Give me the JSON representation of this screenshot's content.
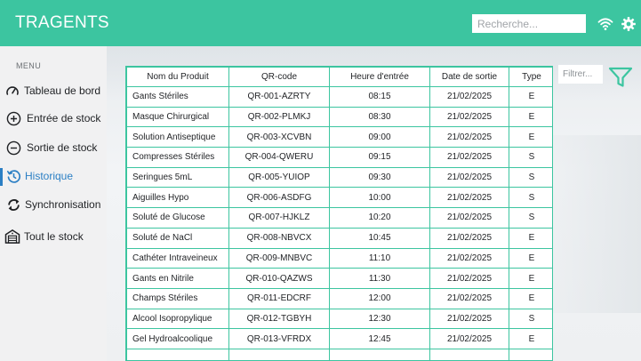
{
  "header": {
    "title": "TRAGENTS",
    "search_placeholder": "Recherche...",
    "icons": [
      "wifi-icon",
      "gear-icon"
    ]
  },
  "sidebar": {
    "menu_label": "MENU",
    "items": [
      {
        "label": "Tableau de bord",
        "icon": "gauge-icon",
        "active": false
      },
      {
        "label": "Entrée de stock",
        "icon": "plus-circle-icon",
        "active": false
      },
      {
        "label": "Sortie de stock",
        "icon": "minus-circle-icon",
        "active": false
      },
      {
        "label": "Historique",
        "icon": "history-icon",
        "active": true
      },
      {
        "label": "Synchronisation",
        "icon": "sync-icon",
        "active": false
      },
      {
        "label": "Tout le stock",
        "icon": "warehouse-icon",
        "active": false
      }
    ]
  },
  "filter": {
    "placeholder": "Filtrer..."
  },
  "table": {
    "headers": [
      "Nom du Produit",
      "QR-code",
      "Heure d'entrée",
      "Date de sortie",
      "Type"
    ],
    "rows": [
      [
        "Gants Stériles",
        "QR-001-AZRTY",
        "08:15",
        "21/02/2025",
        "E"
      ],
      [
        "Masque Chirurgical",
        "QR-002-PLMKJ",
        "08:30",
        "21/02/2025",
        "E"
      ],
      [
        "Solution Antiseptique",
        "QR-003-XCVBN",
        "09:00",
        "21/02/2025",
        "E"
      ],
      [
        "Compresses Stériles",
        "QR-004-QWERU",
        "09:15",
        "21/02/2025",
        "S"
      ],
      [
        "Seringues 5mL",
        "QR-005-YUIOP",
        "09:30",
        "21/02/2025",
        "S"
      ],
      [
        "Aiguilles Hypo",
        "QR-006-ASDFG",
        "10:00",
        "21/02/2025",
        "S"
      ],
      [
        "Soluté de Glucose",
        "QR-007-HJKLZ",
        "10:20",
        "21/02/2025",
        "S"
      ],
      [
        "Soluté de NaCl",
        "QR-008-NBVCX",
        "10:45",
        "21/02/2025",
        "E"
      ],
      [
        "Cathéter Intraveineux",
        "QR-009-MNBVC",
        "11:10",
        "21/02/2025",
        "E"
      ],
      [
        "Gants en Nitrile",
        "QR-010-QAZWS",
        "11:30",
        "21/02/2025",
        "E"
      ],
      [
        "Champs Stériles",
        "QR-011-EDCRF",
        "12:00",
        "21/02/2025",
        "E"
      ],
      [
        "Alcool Isopropylique",
        "QR-012-TGBYH",
        "12:30",
        "21/02/2025",
        "S"
      ],
      [
        "Gel Hydroalcoolique",
        "QR-013-VFRDX",
        "12:45",
        "21/02/2025",
        "E"
      ]
    ]
  },
  "colors": {
    "header_bg": "#3cc5a0",
    "table_border": "#3cc5a0",
    "active_nav": "#2b7fc4",
    "filter_icon": "#3cc5a0"
  }
}
